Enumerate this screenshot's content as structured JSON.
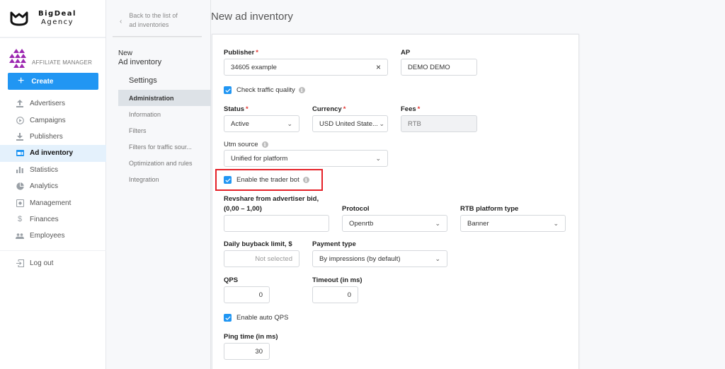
{
  "brand": {
    "line1": "BigDeal",
    "line2": "Agency",
    "role": "AFFILIATE MANAGER",
    "accent": "#2196f3"
  },
  "sidebar": {
    "create_label": "Create",
    "items": [
      {
        "label": "Advertisers",
        "icon": "upload-icon"
      },
      {
        "label": "Campaigns",
        "icon": "play-circle-icon"
      },
      {
        "label": "Publishers",
        "icon": "download-icon"
      },
      {
        "label": "Ad inventory",
        "icon": "ad-inventory-icon",
        "active": true
      },
      {
        "label": "Statistics",
        "icon": "bar-chart-icon"
      },
      {
        "label": "Analytics",
        "icon": "pie-chart-icon"
      },
      {
        "label": "Management",
        "icon": "management-icon"
      },
      {
        "label": "Finances",
        "icon": "dollar-icon"
      },
      {
        "label": "Employees",
        "icon": "people-icon"
      }
    ],
    "logout_label": "Log out"
  },
  "subnav": {
    "back_line1": "Back to the list of",
    "back_line2": "ad inventories",
    "head_line1": "New",
    "head_line2": "Ad inventory",
    "section": "Settings",
    "items": [
      {
        "label": "Administration",
        "active": true
      },
      {
        "label": "Information"
      },
      {
        "label": "Filters"
      },
      {
        "label": "Filters for traffic sour..."
      },
      {
        "label": "Optimization and rules"
      },
      {
        "label": "Integration"
      }
    ]
  },
  "page": {
    "title": "New ad inventory"
  },
  "form": {
    "publisher": {
      "label": "Publisher",
      "value": "34605 example"
    },
    "ap": {
      "label": "AP",
      "value": "DEMO DEMO"
    },
    "check_traffic_quality": {
      "label": "Check traffic quality",
      "checked": true
    },
    "status": {
      "label": "Status",
      "value": "Active"
    },
    "currency": {
      "label": "Currency",
      "value": "USD United State..."
    },
    "fees": {
      "label": "Fees",
      "value": "RTB"
    },
    "utm_source": {
      "label": "Utm source",
      "value": "Unified for platform"
    },
    "trader_bot": {
      "label": "Enable the trader bot",
      "checked": true
    },
    "revshare": {
      "label_line1": "Revshare from advertiser bid,",
      "label_line2": "(0,00 – 1,00)",
      "value": ""
    },
    "protocol": {
      "label": "Protocol",
      "value": "Openrtb"
    },
    "rtb_platform_type": {
      "label": "RTB platform type",
      "value": "Banner"
    },
    "daily_buyback": {
      "label": "Daily buyback limit, $",
      "placeholder": "Not selected"
    },
    "payment_type": {
      "label": "Payment type",
      "value": "By impressions (by default)"
    },
    "qps": {
      "label": "QPS",
      "value": "0"
    },
    "timeout": {
      "label": "Timeout (in ms)",
      "value": "0"
    },
    "auto_qps": {
      "label": "Enable auto QPS",
      "checked": true
    },
    "ping_time": {
      "label": "Ping time (in ms)",
      "value": "30"
    }
  }
}
